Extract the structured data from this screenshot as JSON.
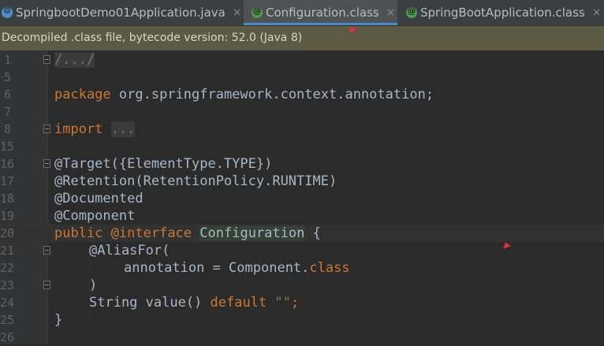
{
  "tabs": [
    {
      "label": "SpringbootDemo01Application.java",
      "icon": "spring-java-class-icon",
      "close": "×"
    },
    {
      "label": "Configuration.class",
      "icon": "annotation-class-icon",
      "close": "×",
      "active": true
    },
    {
      "label": "SpringBootApplication.class",
      "icon": "annotation-class-icon",
      "close": "×"
    }
  ],
  "banner": "Decompiled .class file, bytecode version: 52.0 (Java 8)",
  "lines": [
    {
      "num": "1"
    },
    {
      "num": "5"
    },
    {
      "num": "6"
    },
    {
      "num": "7"
    },
    {
      "num": "8"
    },
    {
      "num": "15"
    },
    {
      "num": "16"
    },
    {
      "num": "17"
    },
    {
      "num": "18"
    },
    {
      "num": "19"
    },
    {
      "num": "20"
    },
    {
      "num": "21"
    },
    {
      "num": "22"
    },
    {
      "num": "23"
    },
    {
      "num": "24"
    },
    {
      "num": "25"
    },
    {
      "num": "26"
    }
  ],
  "code": {
    "l1_fold": "/.../",
    "l6_kw": "package",
    "l6_rest": " org.springframework.context.annotation;",
    "l8_kw": "import",
    "l8_fold": "...",
    "l16": "@Target({ElementType.TYPE})",
    "l17": "@Retention(RetentionPolicy.RUNTIME)",
    "l18": "@Documented",
    "l19": "@Component",
    "l20_kw1": "public",
    "l20_kw2": "@interface",
    "l20_name": "Configuration",
    "l20_brace": " {",
    "l21": "@AliasFor(",
    "l22_a": "annotation = Component.",
    "l22_kw": "class",
    "l23": ")",
    "l24_a": "String value() ",
    "l24_kw": "default",
    "l24_str": "\"\"",
    "l24_end": ";",
    "l25": "}"
  },
  "colors": {
    "keyword": "#cc7832",
    "string": "#6a8759",
    "text": "#a9b7c6",
    "banner": "#5c5a44",
    "active_tab_underline": "#4a88c7"
  }
}
